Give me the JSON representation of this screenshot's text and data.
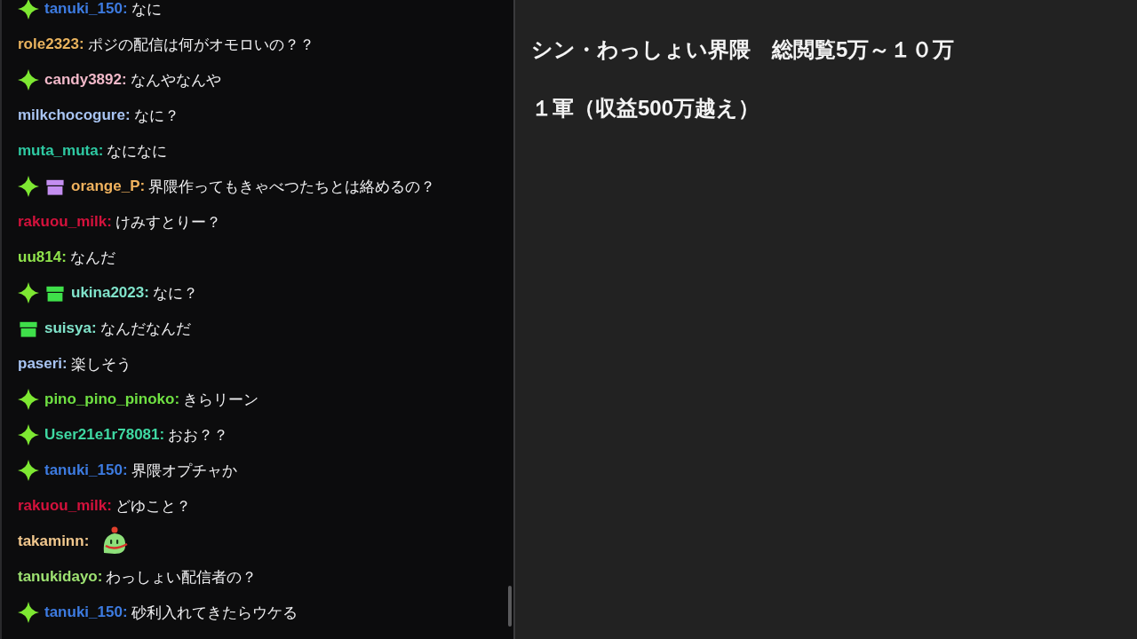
{
  "chat": {
    "messages": [
      {
        "badges": [
          {
            "kind": "sparkle",
            "color": "#7ee832"
          }
        ],
        "user": "tanuki_150:",
        "color": "#3d7be0",
        "kind": "text",
        "text": "なに"
      },
      {
        "user": "role2323:",
        "color": "#e9b35e",
        "kind": "text",
        "text": "ポジの配信は何がオモロいの？？"
      },
      {
        "badges": [
          {
            "kind": "sparkle",
            "color": "#7ee832"
          }
        ],
        "user": "candy3892:",
        "color": "#f2b9c9",
        "kind": "text",
        "text": "なんやなんや"
      },
      {
        "user": "milkchocogure:",
        "color": "#a8c4f2",
        "kind": "text",
        "text": "なに？"
      },
      {
        "user": "muta_muta:",
        "color": "#2ec9a2",
        "kind": "text",
        "text": "なになに"
      },
      {
        "badges": [
          {
            "kind": "sparkle",
            "color": "#7ee832"
          },
          {
            "kind": "gift",
            "color": "#c48ef0"
          }
        ],
        "user": "orange_P:",
        "color": "#f0b25e",
        "kind": "text",
        "text": "界隈作ってもきゃべつたちとは絡めるの？"
      },
      {
        "user": "rakuou_milk:",
        "color": "#d4123c",
        "kind": "text",
        "text": "けみすとりー？"
      },
      {
        "user": "uu814:",
        "color": "#8fe24c",
        "kind": "text",
        "text": "なんだ"
      },
      {
        "badges": [
          {
            "kind": "sparkle",
            "color": "#7ee832"
          },
          {
            "kind": "gift",
            "color": "#3fe04a"
          }
        ],
        "user": "ukina2023:",
        "color": "#80e3ca",
        "kind": "text",
        "text": "なに？"
      },
      {
        "badges": [
          {
            "kind": "gift",
            "color": "#3fe04a"
          }
        ],
        "user": "suisya:",
        "color": "#80e3ca",
        "kind": "text",
        "text": "なんだなんだ"
      },
      {
        "user": "paseri:",
        "color": "#a8c4f2",
        "kind": "text",
        "text": "楽しそう"
      },
      {
        "badges": [
          {
            "kind": "sparkle",
            "color": "#7ee832"
          }
        ],
        "user": "pino_pino_pinoko:",
        "color": "#6fe042",
        "kind": "text",
        "text": "きらリーン"
      },
      {
        "badges": [
          {
            "kind": "sparkle",
            "color": "#7ee832"
          }
        ],
        "user": "User21e1r78081:",
        "color": "#3fd8a2",
        "kind": "text",
        "text": "おお？？"
      },
      {
        "badges": [
          {
            "kind": "sparkle",
            "color": "#7ee832"
          }
        ],
        "user": "tanuki_150:",
        "color": "#3d7be0",
        "kind": "text",
        "text": "界隈オプチャか"
      },
      {
        "user": "rakuou_milk:",
        "color": "#d4123c",
        "kind": "text",
        "text": "どゆこと？"
      },
      {
        "user": "takaminn:",
        "color": "#f2c88e",
        "kind": "emote"
      },
      {
        "user": "tanukidayo:",
        "color": "#9ee272",
        "kind": "text",
        "text": "わっしょい配信者の？"
      },
      {
        "badges": [
          {
            "kind": "sparkle",
            "color": "#7ee832"
          }
        ],
        "user": "tanuki_150:",
        "color": "#3d7be0",
        "kind": "text",
        "text": "砂利入れてきたらウケる"
      }
    ]
  },
  "notes": {
    "lines": [
      "シン・わっしょい界隈　総閲覧5万～１０万",
      "１軍（収益500万越え）"
    ]
  }
}
